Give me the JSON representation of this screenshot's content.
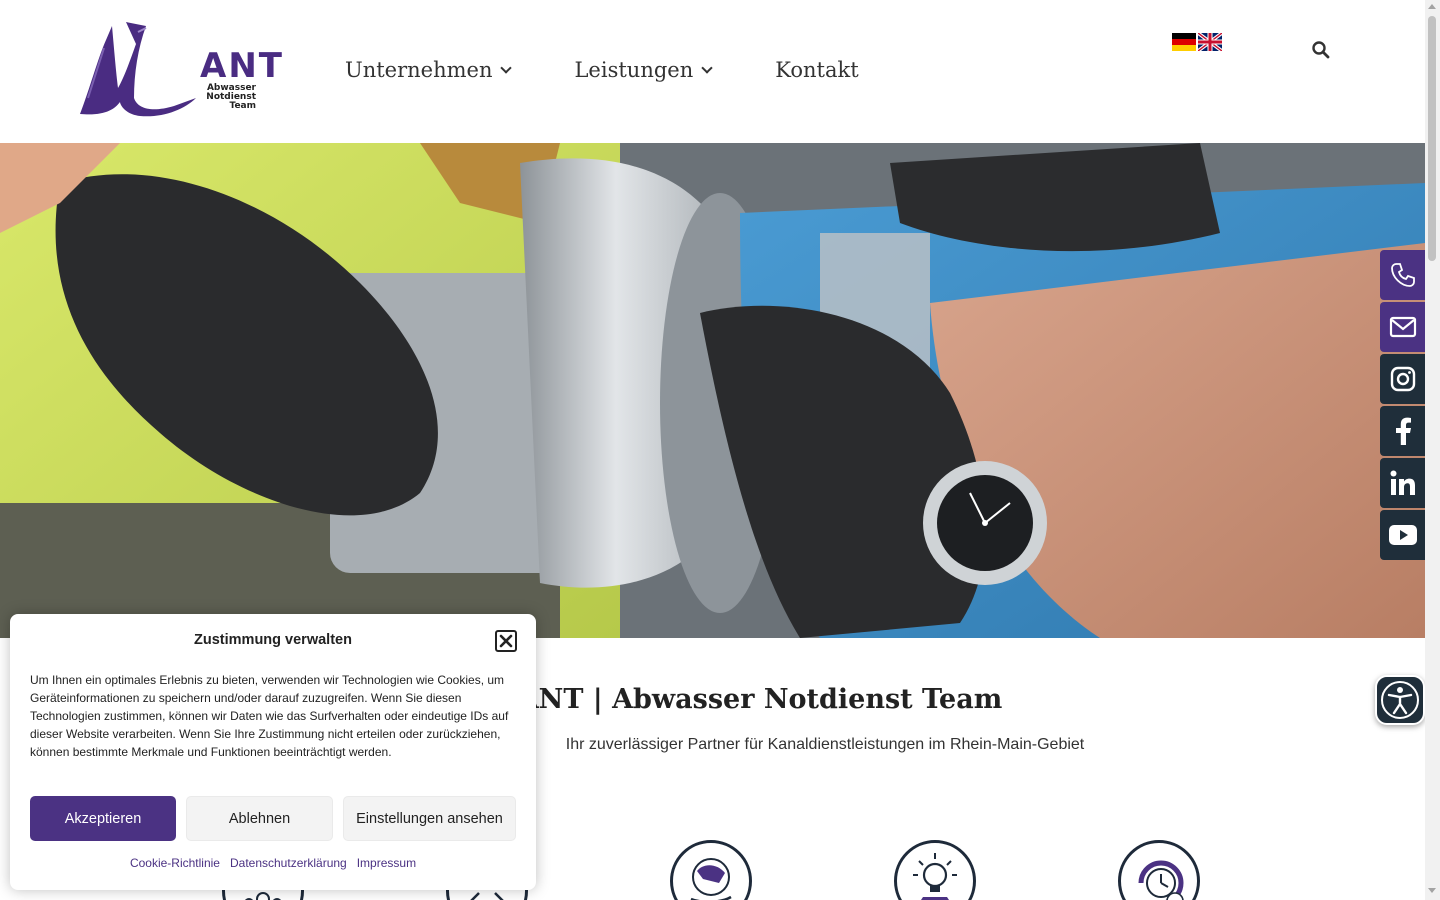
{
  "brand": {
    "logo_text": "ANT",
    "logo_sub_1": "Abwasser",
    "logo_sub_2": "Notdienst",
    "logo_sub_3": "Team",
    "accent_color": "#4b3283",
    "dark_color": "#1f2e3a"
  },
  "nav": {
    "items": [
      {
        "label": "Unternehmen",
        "has_dropdown": true
      },
      {
        "label": "Leistungen",
        "has_dropdown": true
      },
      {
        "label": "Kontakt",
        "has_dropdown": false
      }
    ],
    "languages": [
      "de-flag-icon",
      "uk-flag-icon"
    ],
    "search_icon": "search-icon"
  },
  "social": [
    "phone-icon",
    "mail-icon",
    "instagram-icon",
    "facebook-icon",
    "linkedin-icon",
    "youtube-icon"
  ],
  "main": {
    "headline": "ANT | Abwasser Notdienst Team",
    "subline": "Ihr zuverlässiger Partner für Kanaldienstleistungen im Rhein-Main-Gebiet"
  },
  "cookie": {
    "title": "Zustimmung verwalten",
    "text": "Um Ihnen ein optimales Erlebnis zu bieten, verwenden wir Technologien wie Cookies, um Geräteinformationen zu speichern und/oder darauf zuzugreifen. Wenn Sie diesen Technologien zustimmen, können wir Daten wie das Surfverhalten oder eindeutige IDs auf dieser Website verarbeiten. Wenn Sie Ihre Zustimmung nicht erteilen oder zurückziehen, können bestimmte Merkmale und Funktionen beeinträchtigt werden.",
    "accept": "Akzeptieren",
    "deny": "Ablehnen",
    "settings": "Einstellungen ansehen",
    "links": [
      "Cookie-Richtlinie",
      "Datenschutzerklärung",
      "Impressum"
    ]
  },
  "accessibility_icon": "accessibility-icon"
}
